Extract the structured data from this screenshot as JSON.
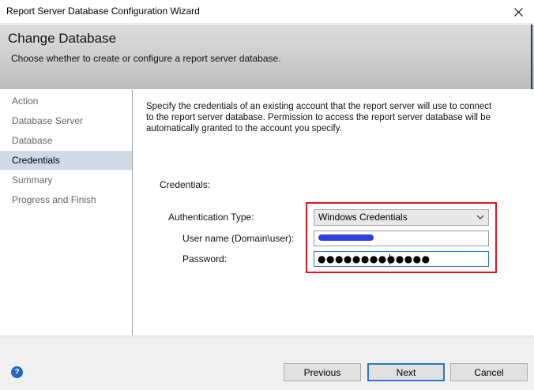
{
  "window": {
    "title": "Report Server Database Configuration Wizard"
  },
  "header": {
    "title": "Change Database",
    "subtitle": "Choose whether to create or configure a report server database."
  },
  "sidebar": {
    "items": [
      {
        "label": "Action"
      },
      {
        "label": "Database Server"
      },
      {
        "label": "Database"
      },
      {
        "label": "Credentials"
      },
      {
        "label": "Summary"
      },
      {
        "label": "Progress and Finish"
      }
    ],
    "active_index": 3
  },
  "main": {
    "description": "Specify the credentials of an existing account that the report server will use to connect to the report server database.  Permission to access the report server database will be automatically granted to the account you specify.",
    "credentials_heading": "Credentials:",
    "auth_type_label": "Authentication Type:",
    "auth_type_value": "Windows Credentials",
    "username_label": "User name (Domain\\user):",
    "password_label": "Password:",
    "password_mask": "●●●●●●●●●●●●●"
  },
  "footer": {
    "previous_label": "Previous",
    "next_label": "Next",
    "cancel_label": "Cancel"
  },
  "colors": {
    "active_item_bg": "#cfd9e8",
    "highlight_box": "#e0141e",
    "focus_border": "#2a77c8"
  },
  "icons": {
    "close": "close-icon",
    "dropdown": "chevron-down-icon",
    "help": "help-icon"
  }
}
